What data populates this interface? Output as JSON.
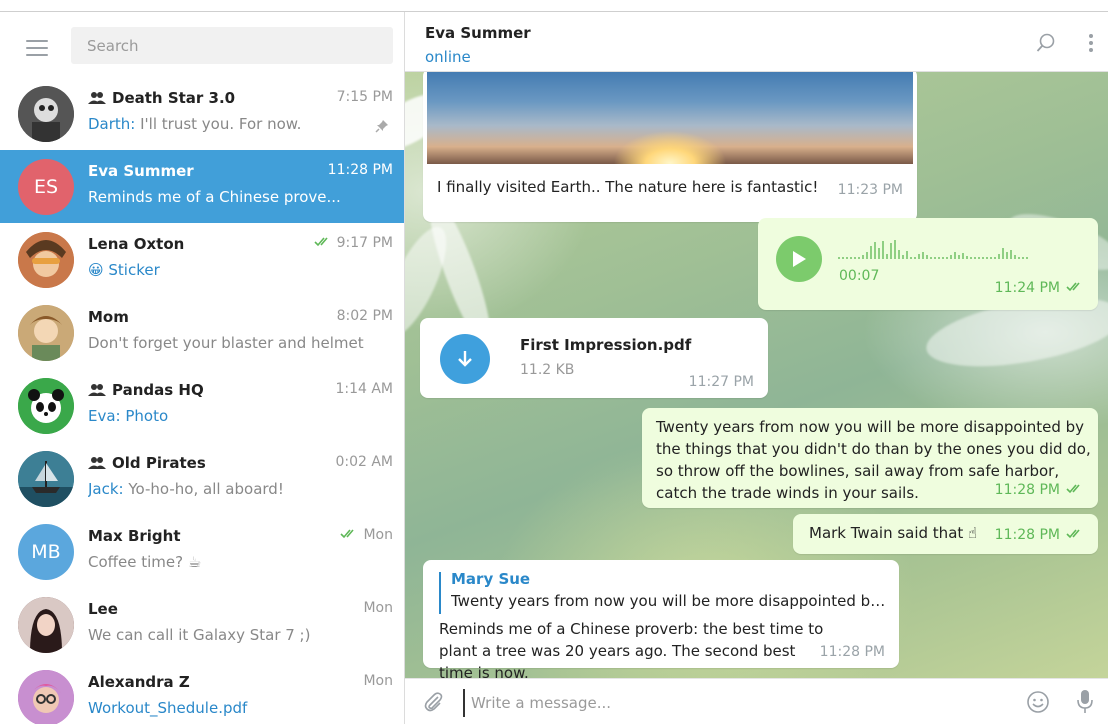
{
  "sidebar": {
    "search_placeholder": "Search",
    "chats": [
      {
        "name": "Death Star 3.0",
        "group": true,
        "time": "7:15 PM",
        "sender": "Darth:",
        "preview": " I'll trust you. For now.",
        "pinned": true,
        "avatar_color": "#4a4a4a"
      },
      {
        "name": "Eva Summer",
        "group": false,
        "time": "11:28 PM",
        "preview": "Reminds me of a Chinese prove...",
        "active": true,
        "avatar_initials": "ES",
        "avatar_color": "#e1636c"
      },
      {
        "name": "Lena Oxton",
        "group": false,
        "time": "9:17 PM",
        "read": true,
        "preview": "😀 Sticker",
        "avatar_color": "#c9784a"
      },
      {
        "name": "Mom",
        "group": false,
        "time": "8:02 PM",
        "preview": "Don't forget your blaster and helmet",
        "avatar_color": "#b99a6a"
      },
      {
        "name": "Pandas HQ",
        "group": true,
        "time": "1:14 AM",
        "sender": "Eva:",
        "preview": " Photo",
        "avatar_color": "#3aa84a"
      },
      {
        "name": "Old Pirates",
        "group": true,
        "time": "0:02 AM",
        "sender": "Jack:",
        "preview": " Yo-ho-ho, all aboard!",
        "avatar_color": "#2e6f86"
      },
      {
        "name": "Max Bright",
        "group": false,
        "time": "Mon",
        "read": true,
        "preview": "Coffee time? ☕",
        "avatar_initials": "MB",
        "avatar_color": "#5ba7dd"
      },
      {
        "name": "Lee",
        "group": false,
        "time": "Mon",
        "preview": "We can call it Galaxy Star 7 ;)",
        "avatar_color": "#8a6a6a"
      },
      {
        "name": "Alexandra Z",
        "group": false,
        "time": "Mon",
        "preview": "Workout_Shedule.pdf",
        "avatar_color": "#b46cc0"
      }
    ]
  },
  "header": {
    "contact_name": "Eva Summer",
    "status": "online"
  },
  "messages": {
    "photo": {
      "caption": "I finally visited Earth.. The nature here is fantastic!",
      "time": "11:23 PM"
    },
    "voice": {
      "duration": "00:07",
      "time": "11:24 PM"
    },
    "file": {
      "name": "First Impression.pdf",
      "size": "11.2 KB",
      "time": "11:27 PM"
    },
    "quote": {
      "text": "Twenty years from now you will be more disappointed by the things that you didn't do than by the ones you did do, so throw off the bowlines, sail away from safe harbor, catch the trade winds in your sails.",
      "time": "11:28 PM"
    },
    "twain": {
      "text": "Mark Twain said that ☝",
      "time": "11:28 PM"
    },
    "reply": {
      "author": "Mary Sue",
      "snippet": "Twenty years from now you will be more disappointed by t...",
      "text": "Reminds me of a Chinese proverb: the best time to plant a tree was 20 years ago. The second best time is now.",
      "time": "11:28 PM"
    }
  },
  "composer": {
    "placeholder": "Write a message..."
  },
  "colors": {
    "accent": "#419fd9",
    "link": "#2a88c9",
    "out_bubble": "#effdde",
    "check": "#5fb858"
  },
  "icons": [
    "menu-icon",
    "group-icon",
    "pin-icon",
    "double-check-icon",
    "search-icon",
    "more-icon",
    "play-icon",
    "download-icon",
    "attach-icon",
    "emoji-icon",
    "mic-icon"
  ]
}
